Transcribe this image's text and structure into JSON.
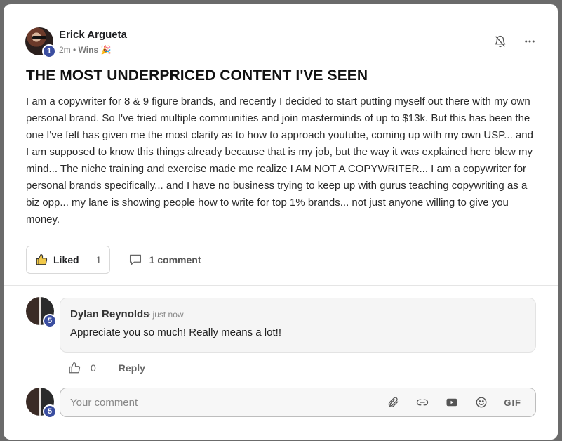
{
  "post": {
    "author": "Erick Argueta",
    "author_level": "1",
    "time": "2m",
    "category": "Wins",
    "category_emoji": "🎉",
    "title": "THE MOST UNDERPRICED CONTENT I'VE SEEN",
    "body": "I am a copywriter for 8 & 9 figure brands, and recently I decided to start putting myself out there with my own personal brand. So I've tried multiple communities and join masterminds of up to $13k. But this has been the one I've felt has given me the most clarity as to how to approach youtube, coming up with my own USP... and I am supposed to know this things already because that is my job, but the way it was explained here blew my mind... The niche training and exercise made me realize I AM NOT A COPYWRITER... I am a copywriter for personal brands specifically... and I have no business trying to keep up with gurus teaching copywriting as a biz opp... my lane is showing people how to write for top 1% brands... not just anyone willing to give you money.",
    "liked_label": "Liked",
    "like_count": "1",
    "comment_count_label": "1 comment"
  },
  "comment": {
    "author": "Dylan Reynolds",
    "author_level": "5",
    "time": "just now",
    "text": "Appreciate you so much! Really means a lot!!",
    "like_count": "0",
    "reply_label": "Reply"
  },
  "composer": {
    "user_level": "5",
    "placeholder": "Your comment",
    "gif_label": "GIF"
  },
  "icons": {
    "bell": "bell-off-icon",
    "more": "more-horizontal-icon",
    "thumbs_up": "thumbs-up-icon",
    "comment": "comment-icon",
    "attach": "paperclip-icon",
    "link": "link-icon",
    "video": "video-icon",
    "emoji": "emoji-icon"
  }
}
